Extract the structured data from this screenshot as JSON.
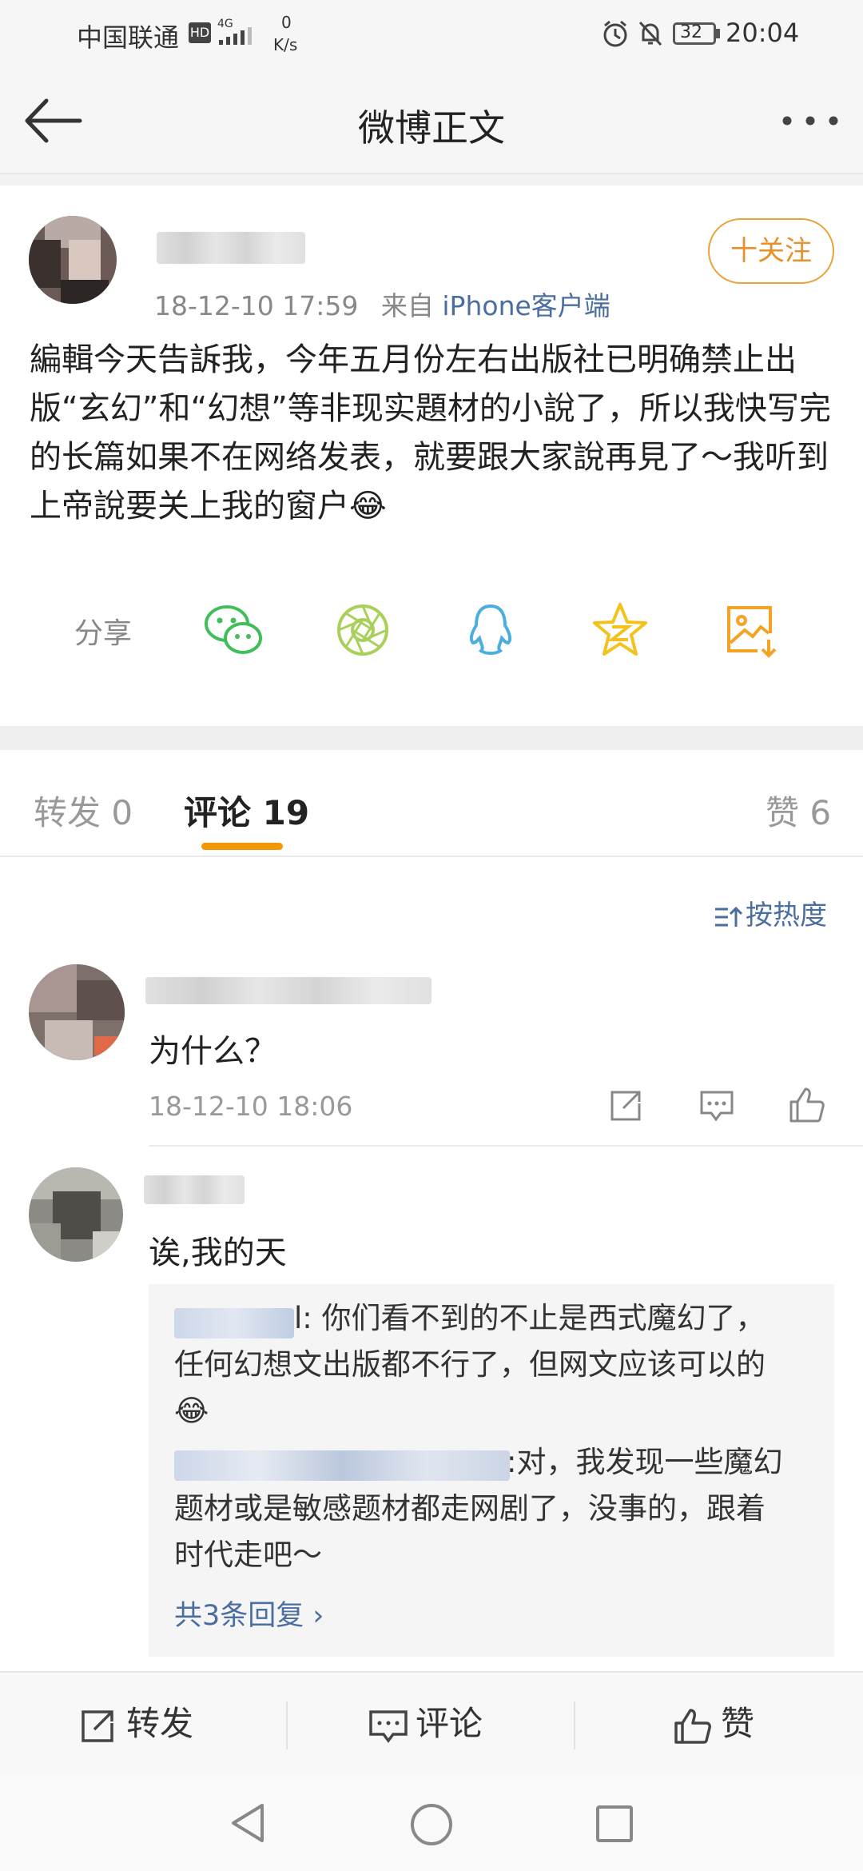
{
  "status_bar": {
    "carrier": "中国联通",
    "hd": "HD",
    "network": "4G",
    "speed_value": "0",
    "speed_unit": "K/s",
    "battery": "32",
    "time": "20:04"
  },
  "nav": {
    "title": "微博正文"
  },
  "post": {
    "time": "18-12-10 17:59",
    "source_prefix": "来自",
    "source": "iPhone客户端",
    "follow_label": "十关注",
    "text": "編輯今天告訴我，今年五月份左右出版社已明确禁止出版“玄幻”和“幻想”等非现实題材的小說了，所以我快写完的长篇如果不在网络发表，就要跟大家說再見了～我听到上帝說要关上我的窗户😂",
    "share_label": "分享",
    "share_icons": [
      "wechat-icon",
      "moments-icon",
      "qq-icon",
      "qzone-icon",
      "save-image-icon"
    ]
  },
  "tabs": {
    "repost": "转发 0",
    "comment": "评论 19",
    "like": "赞 6"
  },
  "sort_label": "按热度",
  "comments": [
    {
      "text": "为什么？",
      "time": "18-12-10 18:06"
    },
    {
      "text": "诶,我的天",
      "replies": [
        "l: 你们看不到的不止是西式魔幻了，",
        "任何幻想文出版都不行了，但网文应该可以的",
        "😂",
        ":对，我发现一些魔幻",
        "题材或是敏感题材都走网剧了，没事的，跟着",
        "时代走吧～"
      ],
      "more_replies": "共3条回复 ›"
    }
  ],
  "bottom_bar": {
    "repost": "转发",
    "comment": "评论",
    "like": "赞"
  },
  "colors": {
    "accent": "#f39800",
    "link": "#4a6ea0",
    "follow": "#e8902a"
  }
}
